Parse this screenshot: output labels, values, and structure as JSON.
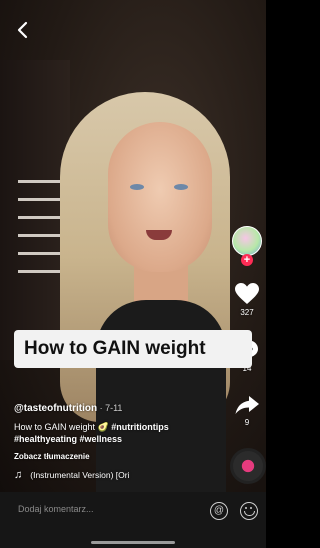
{
  "video": {
    "overlay_text": "How to GAIN weight"
  },
  "rail": {
    "likes": "327",
    "comments": "14",
    "shares": "9"
  },
  "post": {
    "username": "@tasteofnutrition",
    "date": "· 7-11",
    "description_prefix": "How to GAIN weight 🥑",
    "tags_line1": "#nutritiontips",
    "tags_line2": "#healthyeating #wellness",
    "translate_label": "Zobacz tłumaczenie",
    "music_note": "♫",
    "music_label": "(Instrumental Version) [Ori"
  },
  "comment_bar": {
    "placeholder": "Dodaj komentarz..."
  },
  "colors": {
    "follow_badge": "#fe2c55",
    "overlay_bg": "#f2f2f2",
    "comment_bar_bg": "#161616"
  },
  "icons": [
    "back-arrow-icon",
    "heart-icon",
    "comment-icon",
    "share-icon",
    "music-note-icon",
    "at-mention-icon",
    "emoji-icon"
  ]
}
